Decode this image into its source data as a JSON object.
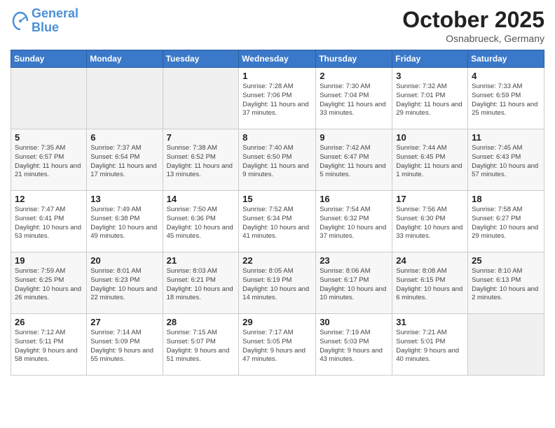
{
  "header": {
    "logo_line1": "General",
    "logo_line2": "Blue",
    "month": "October 2025",
    "location": "Osnabrueck, Germany"
  },
  "days_of_week": [
    "Sunday",
    "Monday",
    "Tuesday",
    "Wednesday",
    "Thursday",
    "Friday",
    "Saturday"
  ],
  "weeks": [
    [
      {
        "day": "",
        "empty": true
      },
      {
        "day": "",
        "empty": true
      },
      {
        "day": "",
        "empty": true
      },
      {
        "day": "1",
        "sunrise": "7:28 AM",
        "sunset": "7:06 PM",
        "daylight": "11 hours and 37 minutes."
      },
      {
        "day": "2",
        "sunrise": "7:30 AM",
        "sunset": "7:04 PM",
        "daylight": "11 hours and 33 minutes."
      },
      {
        "day": "3",
        "sunrise": "7:32 AM",
        "sunset": "7:01 PM",
        "daylight": "11 hours and 29 minutes."
      },
      {
        "day": "4",
        "sunrise": "7:33 AM",
        "sunset": "6:59 PM",
        "daylight": "11 hours and 25 minutes."
      }
    ],
    [
      {
        "day": "5",
        "sunrise": "7:35 AM",
        "sunset": "6:57 PM",
        "daylight": "11 hours and 21 minutes."
      },
      {
        "day": "6",
        "sunrise": "7:37 AM",
        "sunset": "6:54 PM",
        "daylight": "11 hours and 17 minutes."
      },
      {
        "day": "7",
        "sunrise": "7:38 AM",
        "sunset": "6:52 PM",
        "daylight": "11 hours and 13 minutes."
      },
      {
        "day": "8",
        "sunrise": "7:40 AM",
        "sunset": "6:50 PM",
        "daylight": "11 hours and 9 minutes."
      },
      {
        "day": "9",
        "sunrise": "7:42 AM",
        "sunset": "6:47 PM",
        "daylight": "11 hours and 5 minutes."
      },
      {
        "day": "10",
        "sunrise": "7:44 AM",
        "sunset": "6:45 PM",
        "daylight": "11 hours and 1 minute."
      },
      {
        "day": "11",
        "sunrise": "7:45 AM",
        "sunset": "6:43 PM",
        "daylight": "10 hours and 57 minutes."
      }
    ],
    [
      {
        "day": "12",
        "sunrise": "7:47 AM",
        "sunset": "6:41 PM",
        "daylight": "10 hours and 53 minutes."
      },
      {
        "day": "13",
        "sunrise": "7:49 AM",
        "sunset": "6:38 PM",
        "daylight": "10 hours and 49 minutes."
      },
      {
        "day": "14",
        "sunrise": "7:50 AM",
        "sunset": "6:36 PM",
        "daylight": "10 hours and 45 minutes."
      },
      {
        "day": "15",
        "sunrise": "7:52 AM",
        "sunset": "6:34 PM",
        "daylight": "10 hours and 41 minutes."
      },
      {
        "day": "16",
        "sunrise": "7:54 AM",
        "sunset": "6:32 PM",
        "daylight": "10 hours and 37 minutes."
      },
      {
        "day": "17",
        "sunrise": "7:56 AM",
        "sunset": "6:30 PM",
        "daylight": "10 hours and 33 minutes."
      },
      {
        "day": "18",
        "sunrise": "7:58 AM",
        "sunset": "6:27 PM",
        "daylight": "10 hours and 29 minutes."
      }
    ],
    [
      {
        "day": "19",
        "sunrise": "7:59 AM",
        "sunset": "6:25 PM",
        "daylight": "10 hours and 26 minutes."
      },
      {
        "day": "20",
        "sunrise": "8:01 AM",
        "sunset": "6:23 PM",
        "daylight": "10 hours and 22 minutes."
      },
      {
        "day": "21",
        "sunrise": "8:03 AM",
        "sunset": "6:21 PM",
        "daylight": "10 hours and 18 minutes."
      },
      {
        "day": "22",
        "sunrise": "8:05 AM",
        "sunset": "6:19 PM",
        "daylight": "10 hours and 14 minutes."
      },
      {
        "day": "23",
        "sunrise": "8:06 AM",
        "sunset": "6:17 PM",
        "daylight": "10 hours and 10 minutes."
      },
      {
        "day": "24",
        "sunrise": "8:08 AM",
        "sunset": "6:15 PM",
        "daylight": "10 hours and 6 minutes."
      },
      {
        "day": "25",
        "sunrise": "8:10 AM",
        "sunset": "6:13 PM",
        "daylight": "10 hours and 2 minutes."
      }
    ],
    [
      {
        "day": "26",
        "sunrise": "7:12 AM",
        "sunset": "5:11 PM",
        "daylight": "9 hours and 58 minutes."
      },
      {
        "day": "27",
        "sunrise": "7:14 AM",
        "sunset": "5:09 PM",
        "daylight": "9 hours and 55 minutes."
      },
      {
        "day": "28",
        "sunrise": "7:15 AM",
        "sunset": "5:07 PM",
        "daylight": "9 hours and 51 minutes."
      },
      {
        "day": "29",
        "sunrise": "7:17 AM",
        "sunset": "5:05 PM",
        "daylight": "9 hours and 47 minutes."
      },
      {
        "day": "30",
        "sunrise": "7:19 AM",
        "sunset": "5:03 PM",
        "daylight": "9 hours and 43 minutes."
      },
      {
        "day": "31",
        "sunrise": "7:21 AM",
        "sunset": "5:01 PM",
        "daylight": "9 hours and 40 minutes."
      },
      {
        "day": "",
        "empty": true
      }
    ]
  ]
}
